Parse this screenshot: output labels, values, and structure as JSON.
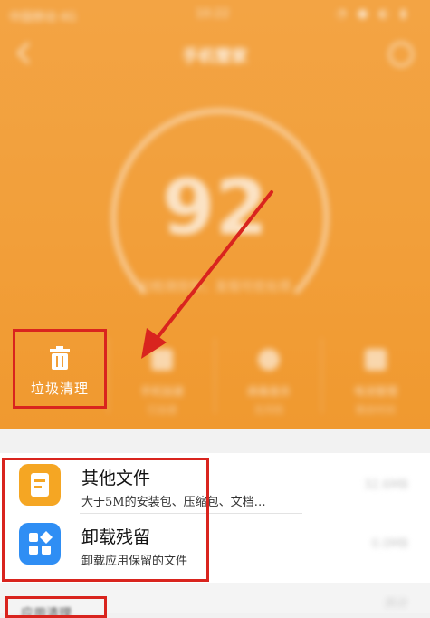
{
  "status_bar": {
    "left": "中国移动 4G",
    "time": "10:22",
    "right": "◔ ● ◐ ▮"
  },
  "header": {
    "title": "手机管家",
    "score": "92",
    "score_sub": "已检测完毕，发现可优化项"
  },
  "tools": [
    {
      "label": "垃圾清理",
      "sub": ""
    },
    {
      "label": "手机加速",
      "sub": "已加速"
    },
    {
      "label": "病毒查杀",
      "sub": "无风险"
    },
    {
      "label": "电池管理",
      "sub": "剩余时间"
    }
  ],
  "list": [
    {
      "name": "其他文件",
      "desc": "大于5M的安装包、压缩包、文档…",
      "size": "32.6MB",
      "icon": "document-icon",
      "color": "#f5a623"
    },
    {
      "name": "卸载残留",
      "desc": "卸载应用保留的文件",
      "size": "0.0MB",
      "icon": "apps-grid-icon",
      "color": "#2f8ef4"
    }
  ],
  "bottom": {
    "section_label": "应用清理",
    "right": "共计"
  },
  "colors": {
    "header_orange": "#f2a03a",
    "annotation_red": "#d9241e"
  }
}
